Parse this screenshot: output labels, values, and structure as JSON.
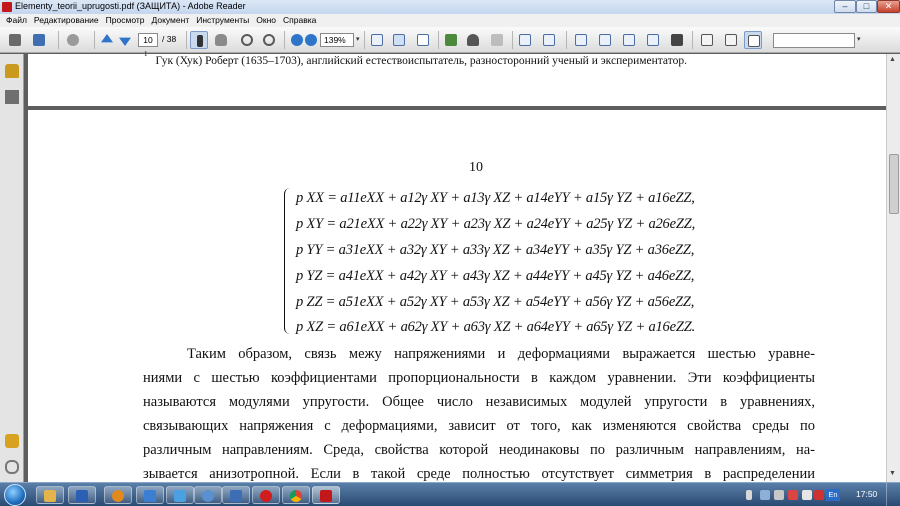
{
  "window": {
    "title": "Elementy_teorii_uprugosti.pdf (ЗАЩИТА) - Adobe Reader",
    "minimize_glyph": "–",
    "maximize_glyph": "□",
    "close_glyph": "✕"
  },
  "menu": {
    "items": [
      "Файл",
      "Редактирование",
      "Просмотр",
      "Документ",
      "Инструменты",
      "Окно",
      "Справка"
    ]
  },
  "toolbar": {
    "current_page": "10",
    "total_pages": "/ 38",
    "zoom": "139%",
    "search_placeholder": "",
    "dropdown_glyph": "▾"
  },
  "document": {
    "footnote_mark": "1",
    "footnote_text": "Гук (Хук) Роберт (1635–1703), английский естествоиспытатель, разносторонний ученый и экспериментатор.",
    "page_number": "10",
    "equations": [
      "p XX = a11eXX + a12γ XY + a13γ XZ + a14eYY + a15γ YZ + a16eZZ,",
      "p XY = a21eXX + a22γ XY + a23γ XZ + a24eYY + a25γ YZ + a26eZZ,",
      "p YY = a31eXX + a32γ XY + a33γ XZ + a34eYY + a35γ YZ + a36eZZ,",
      "p YZ = a41eXX + a42γ XY + a43γ XZ + a44eYY + a45γ YZ + a46eZZ,",
      "p ZZ = a51eXX + a52γ XY + a53γ XZ + a54eYY + a56γ YZ + a56eZZ,",
      "p XZ = a61eXX + a62γ XY + a63γ XZ + a64eYY + a65γ YZ + a16eZZ."
    ],
    "paragraph_lines": [
      "Таким образом, связь межу напряжениями и деформациями выражается шестью уравне-",
      "ниями с шестью коэффициентами пропорциональности в каждом уравнении. Эти коэффициенты",
      "называются модулями упругости. Общее число независимых модулей упругости в уравнениях,",
      "связывающих напряжения с деформациями, зависит от того, как изменяются свойства среды по",
      "различным направлениям. Среда, свойства которой неодинаковы по различным направлениям, на-",
      "зывается анизотропной. Если в такой среде полностью отсутствует симметрия в распределении"
    ]
  },
  "taskbar": {
    "language": "En",
    "clock": "17:50"
  },
  "colors": {
    "doc_background": "#5e5e5e",
    "page": "#ffffff",
    "taskbar": "#2a4a72",
    "reader_red": "#c2181b"
  },
  "icons": {
    "toolbar": [
      "print-icon",
      "save-icon",
      "hand-back-icon",
      "prev-page-icon",
      "next-page-icon",
      "select-tool-icon",
      "hand-tool-icon",
      "zoom-out-icon",
      "zoom-in-icon",
      "zoom-minus-icon",
      "zoom-plus-icon"
    ],
    "nav": [
      "lock-icon",
      "pages-icon",
      "comment-icon",
      "attachment-icon"
    ]
  }
}
